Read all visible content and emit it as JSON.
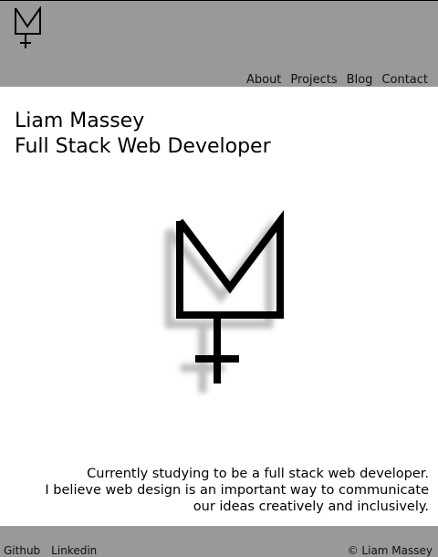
{
  "header": {
    "logo_icon": "lm-monogram-logo",
    "nav": [
      {
        "label": "About"
      },
      {
        "label": "Projects"
      },
      {
        "label": "Blog"
      },
      {
        "label": "Contact"
      }
    ]
  },
  "hero": {
    "name": "Liam Massey",
    "role": "Full Stack Web Developer",
    "logo_icon": "lm-monogram-logo"
  },
  "tagline": {
    "line1": "Currently studying to be a full stack web developer.",
    "line2": "I believe web design is an important way to communicate",
    "line3": "our ideas creatively and inclusively."
  },
  "footer": {
    "links": [
      {
        "label": "Github"
      },
      {
        "label": "Linkedin"
      }
    ],
    "copyright": "© Liam Massey"
  },
  "colors": {
    "header_bg": "#999999",
    "footer_bg": "#999999",
    "text": "#000000",
    "background": "#ffffff"
  }
}
